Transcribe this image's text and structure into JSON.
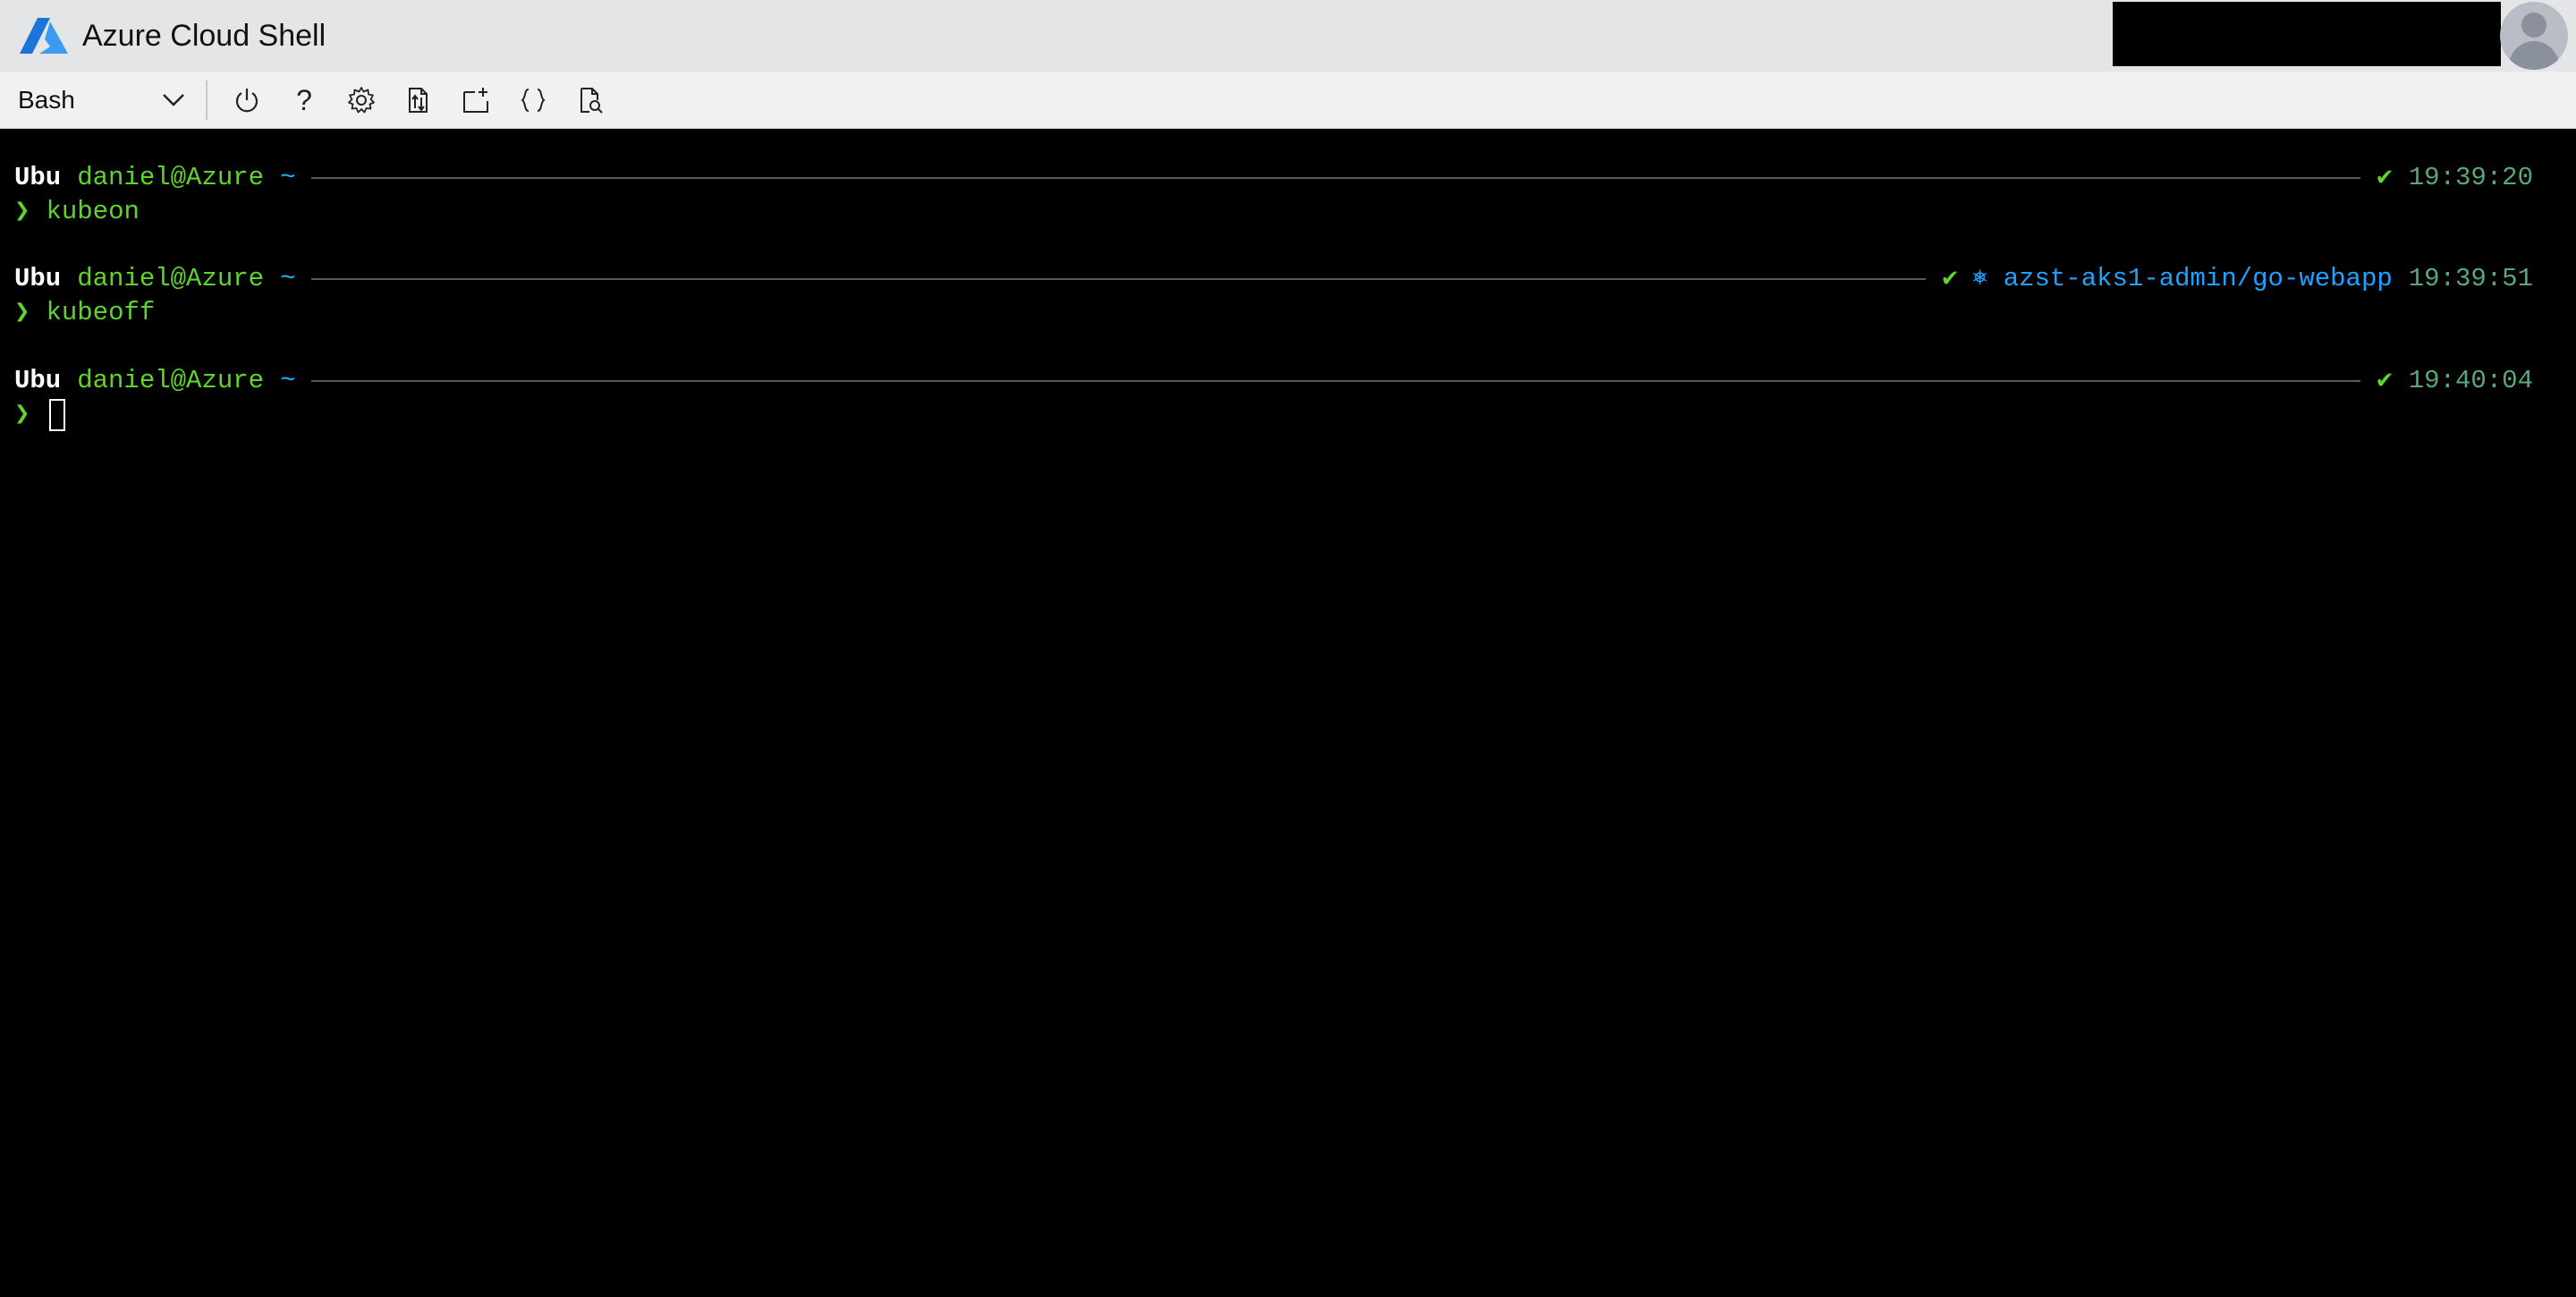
{
  "header": {
    "title": "Azure Cloud Shell",
    "logo_icon": "azure-logo-icon",
    "avatar_icon": "user-avatar-icon"
  },
  "toolbar": {
    "shell": "Bash",
    "buttons": [
      {
        "name": "restart",
        "icon": "power-icon"
      },
      {
        "name": "help",
        "icon": "help-icon",
        "glyph": "?"
      },
      {
        "name": "settings",
        "icon": "gear-icon"
      },
      {
        "name": "upload-download",
        "icon": "upload-download-icon"
      },
      {
        "name": "open-new-session",
        "icon": "new-session-icon"
      },
      {
        "name": "editor",
        "icon": "braces-icon",
        "glyph": "{}"
      },
      {
        "name": "web-preview",
        "icon": "web-preview-icon"
      }
    ]
  },
  "terminal": {
    "colors": {
      "green": "#5fd42b",
      "blue": "#1fa2ff",
      "time": "#5aa878",
      "white": "#ffffff"
    },
    "prompts": [
      {
        "os": "Ubu",
        "user": "daniel@Azure",
        "dir": "~",
        "status": "✔",
        "context": "",
        "time": "19:39:20",
        "arrow": "❯",
        "command": "kubeon"
      },
      {
        "os": "Ubu",
        "user": "daniel@Azure",
        "dir": "~",
        "status": "✔",
        "context": "⎈ azst-aks1-admin/go-webapp",
        "time": "19:39:51",
        "arrow": "❯",
        "command": "kubeoff"
      },
      {
        "os": "Ubu",
        "user": "daniel@Azure",
        "dir": "~",
        "status": "✔",
        "context": "",
        "time": "19:40:04",
        "arrow": "❯",
        "command": ""
      }
    ]
  }
}
